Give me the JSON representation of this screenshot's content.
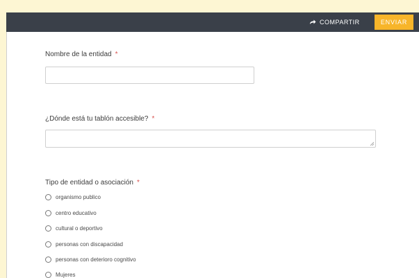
{
  "toolbar": {
    "share_label": "COMPARTIR",
    "send_label": "ENVIAR"
  },
  "form": {
    "field1": {
      "label": "Nombre de la entidad",
      "required_mark": "*",
      "value": ""
    },
    "field2": {
      "label": "¿Dónde está tu tablón accesible?",
      "required_mark": "*",
      "value": ""
    },
    "field3": {
      "label": "Tipo de entidad o asociación",
      "required_mark": "*",
      "options": [
        "organismo publico",
        "centro educativo",
        "cultural o deportivo",
        "personas con discapacidad",
        "personas con deterioro cognitivo",
        "Mujeres"
      ]
    }
  },
  "colors": {
    "topbar": "#3a4049",
    "accent": "#f7b52a",
    "required": "#d9534f",
    "outer_background": "#fdf6d3"
  },
  "icons": {
    "share": "share-arrow-icon",
    "radio": "radio-button-icon",
    "resize": "resize-grip-icon"
  }
}
